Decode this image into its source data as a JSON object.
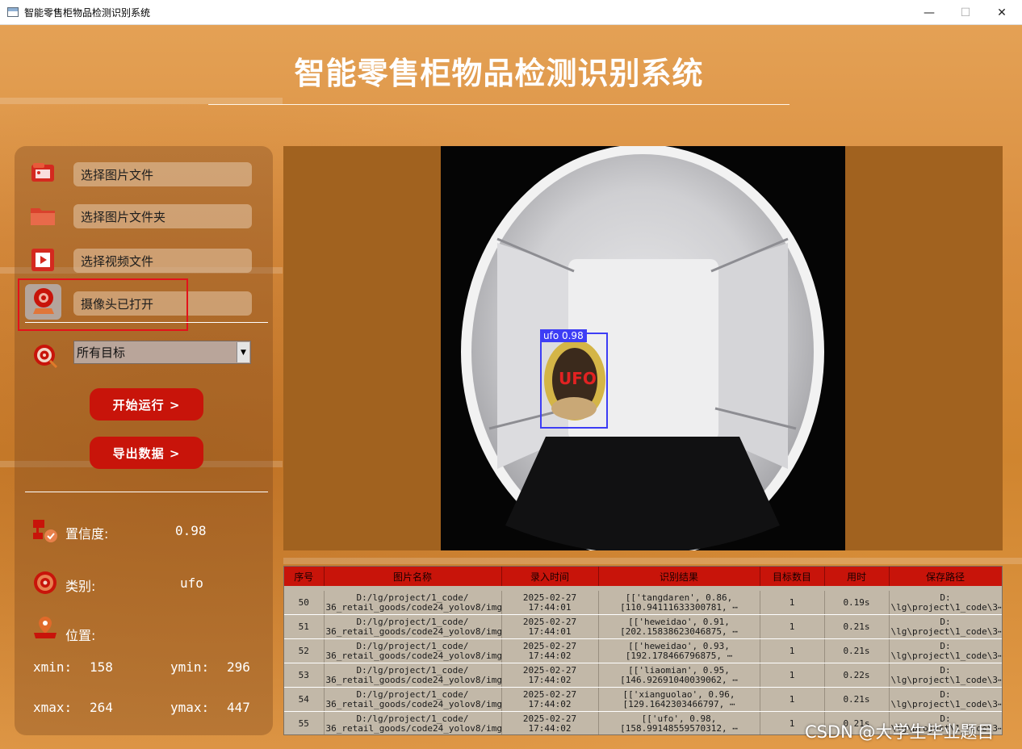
{
  "window": {
    "title": "智能零售柜物品检测识别系统",
    "minimize": "—",
    "maximize": "☐",
    "close": "✕"
  },
  "heading": "智能零售柜物品检测识别系统",
  "sidebar": {
    "buttons": [
      {
        "label": "选择图片文件"
      },
      {
        "label": "选择图片文件夹"
      },
      {
        "label": "选择视频文件"
      },
      {
        "label": "摄像头已打开"
      }
    ],
    "target_select": {
      "value": "所有目标",
      "arrow": "▼"
    },
    "start_label": "开始运行 >",
    "export_label": "导出数据 >",
    "confidence_label": "置信度:",
    "confidence_value": "0.98",
    "class_label": "类别:",
    "class_value": "ufo",
    "position_label": "位置:",
    "xmin_label": "xmin:",
    "xmin_value": "158",
    "ymin_label": "ymin:",
    "ymin_value": "296",
    "xmax_label": "xmax:",
    "xmax_value": "264",
    "ymax_label": "ymax:",
    "ymax_value": "447"
  },
  "detection": {
    "label": "ufo 0.98",
    "box_color": "#3d3df5"
  },
  "table": {
    "headers": [
      "序号",
      "图片名称",
      "录入时间",
      "识别结果",
      "目标数目",
      "用时",
      "保存路径"
    ],
    "rows": [
      {
        "id": "50",
        "name1": "D:/lg/project/1_code/",
        "name2": "36_retail_goods/code24_yolov8/img⋯",
        "date": "2025-02-27",
        "time": "17:44:01",
        "res1": "[['tangdaren', 0.86,",
        "res2": "[110.94111633300781, ⋯",
        "count": "1",
        "dur": "0.19s",
        "path1": "D:",
        "path2": "\\lg\\project\\1_code\\3⋯"
      },
      {
        "id": "51",
        "name1": "D:/lg/project/1_code/",
        "name2": "36_retail_goods/code24_yolov8/img⋯",
        "date": "2025-02-27",
        "time": "17:44:01",
        "res1": "[['heweidao', 0.91,",
        "res2": "[202.15838623046875, ⋯",
        "count": "1",
        "dur": "0.21s",
        "path1": "D:",
        "path2": "\\lg\\project\\1_code\\3⋯"
      },
      {
        "id": "52",
        "name1": "D:/lg/project/1_code/",
        "name2": "36_retail_goods/code24_yolov8/img⋯",
        "date": "2025-02-27",
        "time": "17:44:02",
        "res1": "[['heweidao', 0.93,",
        "res2": "[192.178466796875, ⋯",
        "count": "1",
        "dur": "0.21s",
        "path1": "D:",
        "path2": "\\lg\\project\\1_code\\3⋯"
      },
      {
        "id": "53",
        "name1": "D:/lg/project/1_code/",
        "name2": "36_retail_goods/code24_yolov8/img⋯",
        "date": "2025-02-27",
        "time": "17:44:02",
        "res1": "[['liaomian', 0.95,",
        "res2": "[146.92691040039062, ⋯",
        "count": "1",
        "dur": "0.22s",
        "path1": "D:",
        "path2": "\\lg\\project\\1_code\\3⋯"
      },
      {
        "id": "54",
        "name1": "D:/lg/project/1_code/",
        "name2": "36_retail_goods/code24_yolov8/img⋯",
        "date": "2025-02-27",
        "time": "17:44:02",
        "res1": "[['xianguolao', 0.96,",
        "res2": "[129.1642303466797, ⋯",
        "count": "1",
        "dur": "0.21s",
        "path1": "D:",
        "path2": "\\lg\\project\\1_code\\3⋯"
      },
      {
        "id": "55",
        "name1": "D:/lg/project/1_code/",
        "name2": "36_retail_goods/code24_yolov8/img⋯",
        "date": "2025-02-27",
        "time": "17:44:02",
        "res1": "[['ufo', 0.98,",
        "res2": "[158.99148559570312, ⋯",
        "count": "1",
        "dur": "0.21s",
        "path1": "D:",
        "path2": "\\lg\\project\\1_code\\3⋯"
      }
    ]
  },
  "watermark": "CSDN @大学生毕业题目"
}
